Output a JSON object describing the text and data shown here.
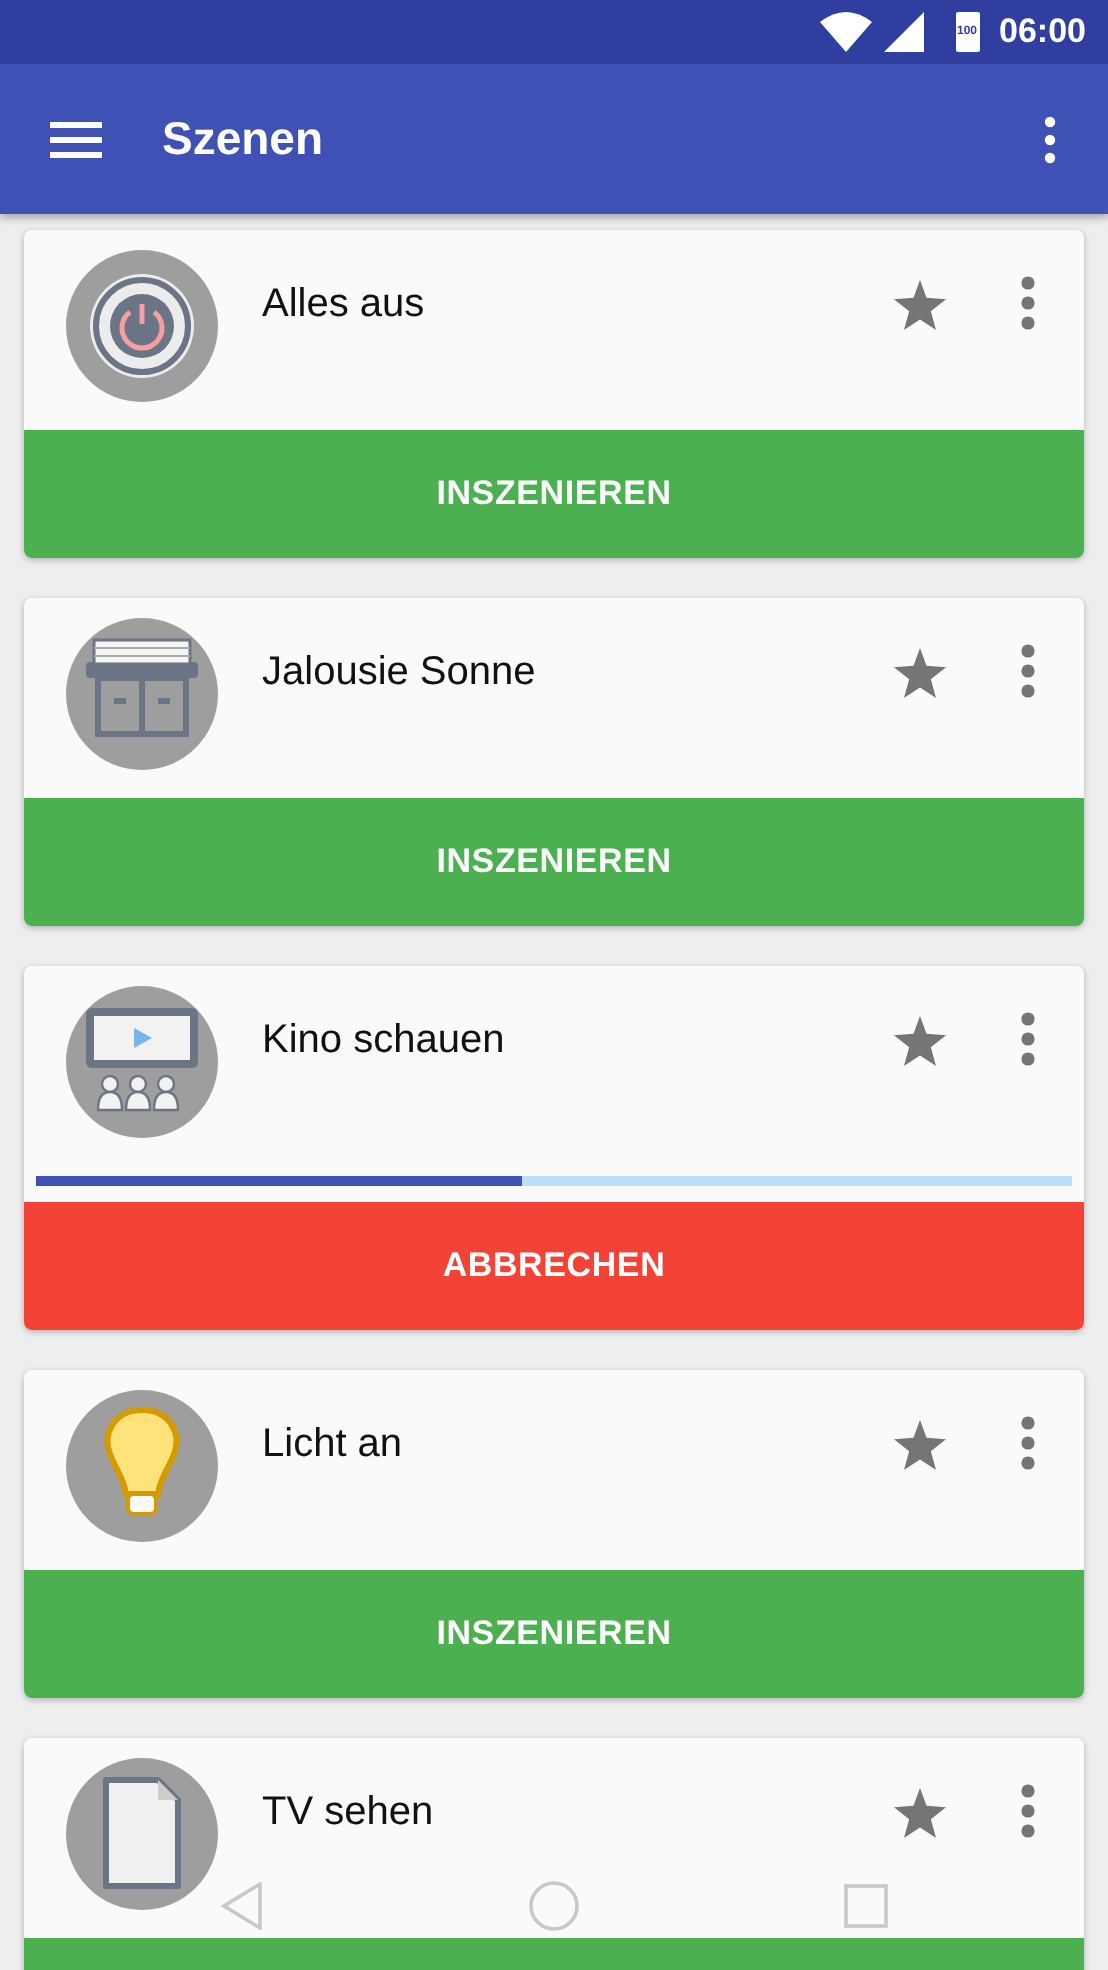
{
  "status_bar": {
    "time": "06:00",
    "battery": "100"
  },
  "app_bar": {
    "title": "Szenen"
  },
  "scenes": [
    {
      "title": "Alles aus",
      "kind": "power",
      "action": {
        "kind": "start",
        "label": "INSZENIEREN"
      }
    },
    {
      "title": "Jalousie Sonne",
      "kind": "blinds",
      "action": {
        "kind": "start",
        "label": "INSZENIEREN"
      }
    },
    {
      "title": "Kino schauen",
      "kind": "cinema",
      "progress": {
        "level": 0.47
      },
      "action": {
        "kind": "cancel",
        "label": "ABBRECHEN"
      }
    },
    {
      "title": "Licht an",
      "kind": "bulb",
      "action": {
        "kind": "start",
        "label": "INSZENIEREN"
      }
    },
    {
      "title": "TV sehen",
      "kind": "document",
      "action": {
        "kind": "start"
      }
    }
  ]
}
